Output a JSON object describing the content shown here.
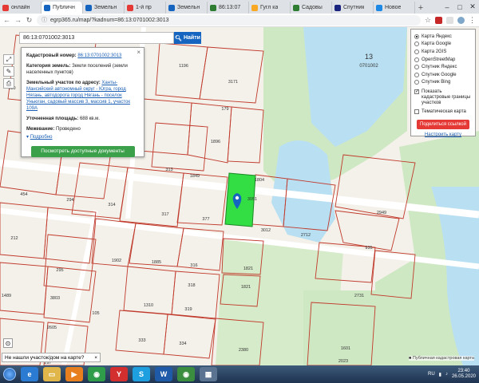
{
  "browser": {
    "tabs": [
      {
        "label": "онлайн",
        "color": "#e53935"
      },
      {
        "label": "Публичн",
        "color": "#1565c0",
        "active": true
      },
      {
        "label": "Земельн",
        "color": "#1565c0"
      },
      {
        "label": "1-й пр",
        "color": "#e53935"
      },
      {
        "label": "Земельн",
        "color": "#1565c0"
      },
      {
        "label": "86:13:07",
        "color": "#2e7d32"
      },
      {
        "label": "Гугл ка",
        "color": "#f9a825"
      },
      {
        "label": "Садовы",
        "color": "#2e7d32"
      },
      {
        "label": "Спутник",
        "color": "#1a237e"
      },
      {
        "label": "Новое",
        "color": "#1e88e5"
      }
    ],
    "url": "egrp365.ru/map/?kadnum=86:13:0701002:3013",
    "colors": {
      "accent": "#1565c0",
      "highlight": "#33dd44"
    }
  },
  "search": {
    "value": "86:13:0701002:3013",
    "button_label": "Найти",
    "icon": "search-icon"
  },
  "info_panel": {
    "kadnum_label": "Кадастровый номер:",
    "kadnum_value": "86:13:0701002:3013",
    "category_label": "Категория земель:",
    "category_value": "Земли поселений (земли населенных пунктов)",
    "address_label": "Земельный участок по адресу:",
    "address_value": "Ханты-Мансийский автономный округ - Югра, город Нягань, автодорога город Нягань - поселок Уньюган, садовый массив 3, массив 1, участок 109А",
    "area_label": "Уточненная площадь:",
    "area_value": "688 кв.м.",
    "survey_label": "Межевание:",
    "survey_value": "Проведено",
    "more_label": "Подробно",
    "docs_button": "Посмотреть доступные документы"
  },
  "layers": {
    "options": [
      "Карта Яндекс",
      "Карта Google",
      "Карта 2GIS",
      "OpenStreetMap",
      "Спутник Яндекс",
      "Спутник Google",
      "Спутник Bing"
    ],
    "selected": 0,
    "show_boundaries": "Показать кадастровые границы участков",
    "thematic": "Тематическая карта",
    "share_button": "Поделиться ссылкой",
    "configure_link": "Настроить карту"
  },
  "map": {
    "block_number": "13",
    "block_code": "0701002",
    "parcels": [
      "3171",
      "1196",
      "179",
      "130",
      "1896",
      "1849",
      "1804",
      "313",
      "454",
      "294",
      "314",
      "317",
      "377",
      "3012",
      "2712",
      "2949",
      "212",
      "1902",
      "935",
      "295",
      "1885",
      "316",
      "1821",
      "3803",
      "318",
      "1489",
      "1821",
      "1310",
      "319",
      "2731",
      "105",
      "2605",
      "333",
      "2380",
      "334",
      "1601",
      "297",
      "2023",
      "3051"
    ],
    "not_found": "Не нашли участок/дом на карте?",
    "copyright": "Публичная кадастровая карта"
  },
  "taskbar": {
    "lang": "RU",
    "time": "23:40",
    "date": "26.05.2020",
    "apps": [
      "ie-icon",
      "explorer-icon",
      "media-icon",
      "chrome-icon",
      "yandex-icon",
      "skype-icon",
      "word-icon",
      "chrome2-icon",
      "calc-icon"
    ]
  }
}
